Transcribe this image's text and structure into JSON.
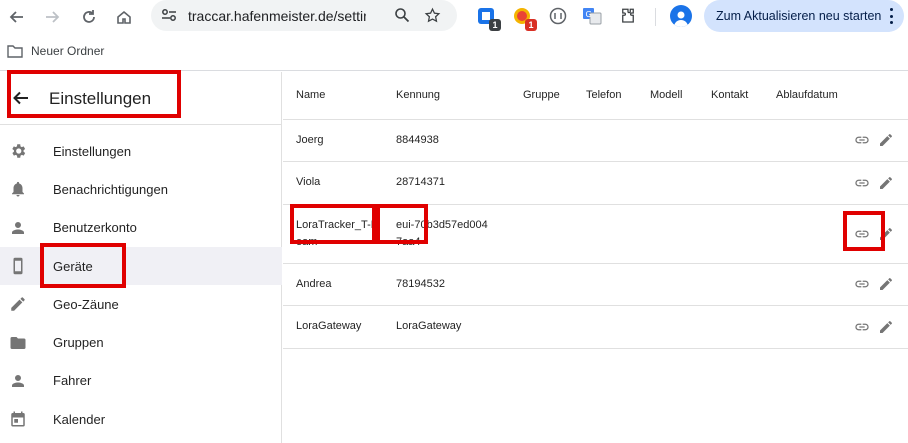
{
  "browser": {
    "url": "traccar.hafenmeister.de/settin",
    "update_button_label": "Zum Aktualisieren neu starten",
    "extensions": [
      {
        "icon": "extension-icon-1",
        "badge": "1",
        "color": "#1a73e8"
      },
      {
        "icon": "extension-icon-2",
        "badge": "1",
        "color": "#ea4335"
      }
    ]
  },
  "bookmarks": {
    "folder_label": "Neuer Ordner"
  },
  "sidebar": {
    "title": "Einstellungen",
    "items": [
      {
        "label": "Einstellungen",
        "icon": "gear-icon",
        "active": false
      },
      {
        "label": "Benachrichtigungen",
        "icon": "bell-icon",
        "active": false
      },
      {
        "label": "Benutzerkonto",
        "icon": "person-icon",
        "active": false
      },
      {
        "label": "Geräte",
        "icon": "smartphone-icon",
        "active": true
      },
      {
        "label": "Geo-Zäune",
        "icon": "pencil-icon",
        "active": false
      },
      {
        "label": "Gruppen",
        "icon": "folder-icon",
        "active": false
      },
      {
        "label": "Fahrer",
        "icon": "person-icon",
        "active": false
      },
      {
        "label": "Kalender",
        "icon": "calendar-icon",
        "active": false
      }
    ]
  },
  "table": {
    "columns": [
      "Name",
      "Kennung",
      "Gruppe",
      "Telefon",
      "Modell",
      "Kontakt",
      "Ablaufdatum"
    ],
    "rows": [
      {
        "name": "Joerg",
        "kennung": "8844938"
      },
      {
        "name": "Viola",
        "kennung": "28714371"
      },
      {
        "name": "LoraTracker_T-Beam",
        "kennung": "eui-70b3d57ed0047aa4"
      },
      {
        "name": "Andrea",
        "kennung": "78194532"
      },
      {
        "name": "LoraGateway",
        "kennung": "LoraGateway"
      }
    ]
  },
  "colors": {
    "annotation": "#e00000",
    "active_item_bg": "#f0f0f5",
    "icon_grey": "#757575"
  }
}
